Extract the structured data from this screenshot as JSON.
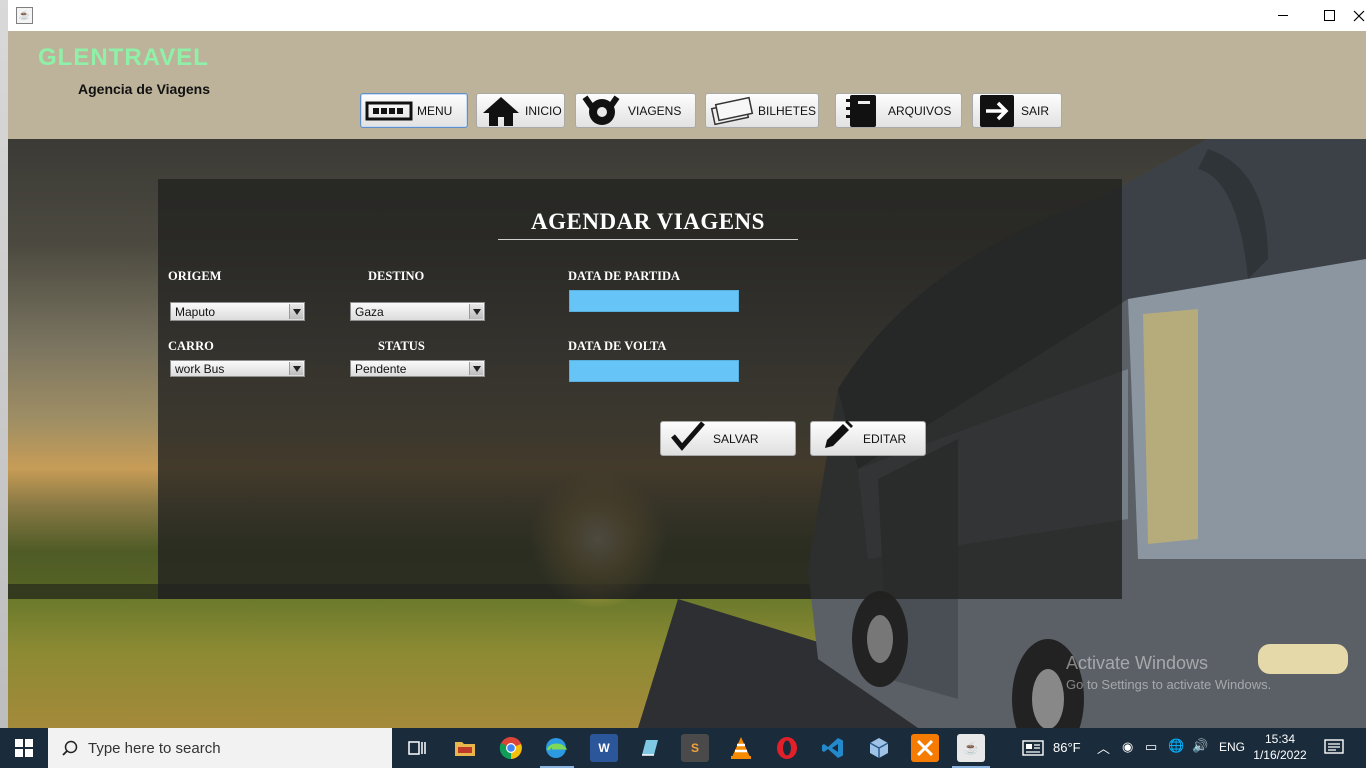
{
  "app": {
    "brand": "GLENTRAVEL",
    "subtitle": "Agencia de Viagens",
    "title_icon": "java-icon"
  },
  "window_controls": [
    "minimize",
    "maximize",
    "close"
  ],
  "nav": [
    {
      "label": "MENU",
      "icon": "keyboard-icon",
      "active": true
    },
    {
      "label": "INICIO",
      "icon": "home-icon"
    },
    {
      "label": "VIAGENS",
      "icon": "tools-icon"
    },
    {
      "label": "BILHETES",
      "icon": "ticket-icon"
    },
    {
      "label": "ARQUIVOS",
      "icon": "notebook-icon"
    },
    {
      "label": "SAIR",
      "icon": "exit-arrow-icon"
    }
  ],
  "form": {
    "title": "AGENDAR VIAGENS",
    "labels": {
      "origem": "ORIGEM",
      "destino": "DESTINO",
      "data_partida": "DATA DE PARTIDA",
      "carro": "CARRO",
      "status": "STATUS",
      "data_volta": "DATA DE VOLTA"
    },
    "values": {
      "origem": "Maputo",
      "destino": "Gaza",
      "carro": "work Bus",
      "status": "Pendente",
      "data_partida": "",
      "data_volta": ""
    },
    "date_field_color": "#66c4f6",
    "actions": {
      "save": "SALVAR",
      "edit": "EDITAR"
    }
  },
  "watermark": {
    "line1": "Activate Windows",
    "line2": "Go to Settings to activate Windows."
  },
  "taskbar": {
    "search_placeholder": "Type here to search",
    "apps": [
      "task-view-icon",
      "file-explorer-icon",
      "chrome-icon",
      "edge-icon",
      "word-icon",
      "notepad-icon",
      "sublime-icon",
      "vlc-icon",
      "opera-icon",
      "vscode-icon",
      "virtualbox-icon",
      "xampp-icon",
      "java-icon"
    ],
    "weather": "86°F",
    "language": "ENG",
    "time": "15:34",
    "date": "1/16/2022"
  }
}
